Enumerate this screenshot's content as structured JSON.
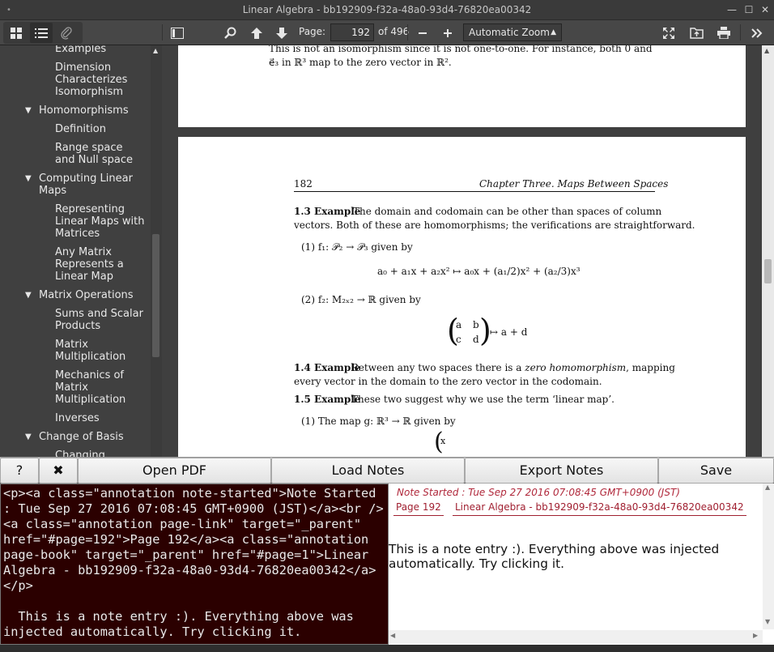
{
  "window": {
    "title": "Linear Algebra - bb192909-f32a-48a0-93d4-76820ea00342",
    "minimize": "—",
    "maximize": "☐",
    "close": "✕"
  },
  "toolbar": {
    "page_label": "Page:",
    "page_value": "192",
    "page_of": "of 496",
    "zoom_value": "Automatic Zoom",
    "minus": "—",
    "plus": "+"
  },
  "sidebar": {
    "items": [
      {
        "label": "Examples",
        "level": 2
      },
      {
        "label": "Dimension Characterizes Isomorphism",
        "level": 2
      },
      {
        "label": "Homomorphisms",
        "level": 1
      },
      {
        "label": "Definition",
        "level": 2
      },
      {
        "label": "Range space and Null space",
        "level": 2
      },
      {
        "label": "Computing Linear Maps",
        "level": 1
      },
      {
        "label": "Representing Linear Maps with Matrices",
        "level": 2
      },
      {
        "label": "Any Matrix Represents a Linear Map",
        "level": 2
      },
      {
        "label": "Matrix Operations",
        "level": 1
      },
      {
        "label": "Sums and Scalar Products",
        "level": 2
      },
      {
        "label": "Matrix Multiplication",
        "level": 2
      },
      {
        "label": "Mechanics of Matrix Multiplication",
        "level": 2
      },
      {
        "label": "Inverses",
        "level": 2
      },
      {
        "label": "Change of Basis",
        "level": 1
      },
      {
        "label": "Changing",
        "level": 2
      }
    ]
  },
  "document": {
    "prev_page_line1": "This is not an isomorphism since it is not one-to-one. For instance, both 0 and",
    "prev_page_line2": "e⃗₃ in ℝ³ map to the zero vector in ℝ².",
    "page_number": "182",
    "running_head": "Chapter Three. Maps Between Spaces",
    "ex13_label": "1.3 Example",
    "ex13_line1": "The domain and codomain can be other than spaces of column",
    "ex13_line2": "vectors. Both of these are homomorphisms; the verifications are straightforward.",
    "item1": "(1)  f₁: 𝒫₂ → 𝒫₃ given by",
    "eq1": "a₀ + a₁x + a₂x²  ↦  a₀x + (a₁/2)x² + (a₂/3)x³",
    "item2": "(2)  f₂: M₂ₓ₂ → ℝ given by",
    "mat_a": "a",
    "mat_b": "b",
    "mat_c": "c",
    "mat_d": "d",
    "eq2": "↦ a + d",
    "ex14_label": "1.4 Example",
    "ex14_line1a": "Between any two spaces there is a ",
    "ex14_italic": "zero homomorphism",
    "ex14_line1b": ", mapping",
    "ex14_line2": "every vector in the domain to the zero vector in the codomain.",
    "ex15_label": "1.5 Example",
    "ex15_line1": "These two suggest why we use the term ‘linear map’.",
    "ex15_item1": "(1)  The map g: ℝ³ → ℝ given by",
    "ex15_vec": "x"
  },
  "notes_toolbar": {
    "help": "?",
    "close": "✖",
    "open_pdf": "Open PDF",
    "load_notes": "Load Notes",
    "export_notes": "Export Notes",
    "save": "Save"
  },
  "editor": {
    "content": "<p><a class=\"annotation note-started\">Note Started : Tue Sep 27 2016 07:08:45 GMT+0900 (JST)</a><br /><a class=\"annotation page-link\" target=\"_parent\" href=\"#page=192\">Page 192</a><a class=\"annotation page-book\" target=\"_parent\" href=\"#page=1\">Linear Algebra - bb192909-f32a-48a0-93d4-76820ea00342</a></p>\n\n  This is a note entry :). Everything above was injected automatically. Try clicking it."
  },
  "preview": {
    "note_started": "Note Started : Tue Sep 27 2016 07:08:45 GMT+0900 (JST)",
    "page_link": "Page 192",
    "book_link": "Linear Algebra - bb192909-f32a-48a0-93d4-76820ea00342",
    "body": "This is a note entry :). Everything above was injected automatically. Try clicking it."
  }
}
